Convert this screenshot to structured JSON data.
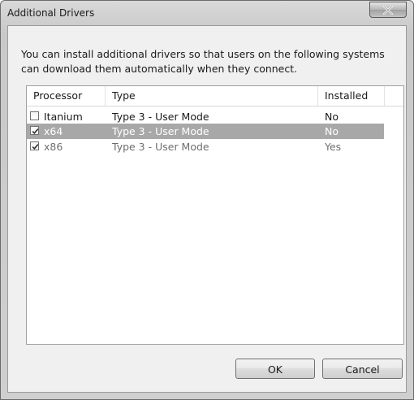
{
  "window": {
    "title": "Additional Drivers",
    "close_glyph": "X"
  },
  "intro_text": "You can install additional drivers so that users on the following systems can download them automatically when they connect.",
  "list": {
    "columns": [
      "Processor",
      "Type",
      "Installed"
    ],
    "rows": [
      {
        "checked": false,
        "processor": "Itanium",
        "type": "Type 3 - User Mode",
        "installed": "No"
      },
      {
        "checked": true,
        "processor": "x64",
        "type": "Type 3 - User Mode",
        "installed": "No",
        "selected": true
      },
      {
        "checked": true,
        "processor": "x86",
        "type": "Type 3 - User Mode",
        "installed": "Yes"
      }
    ]
  },
  "buttons": {
    "ok": "OK",
    "cancel": "Cancel"
  },
  "colors": {
    "selection": "#a8a8a8",
    "disabled_text": "#6f6f6f",
    "client_bg": "#f0f0f0"
  }
}
